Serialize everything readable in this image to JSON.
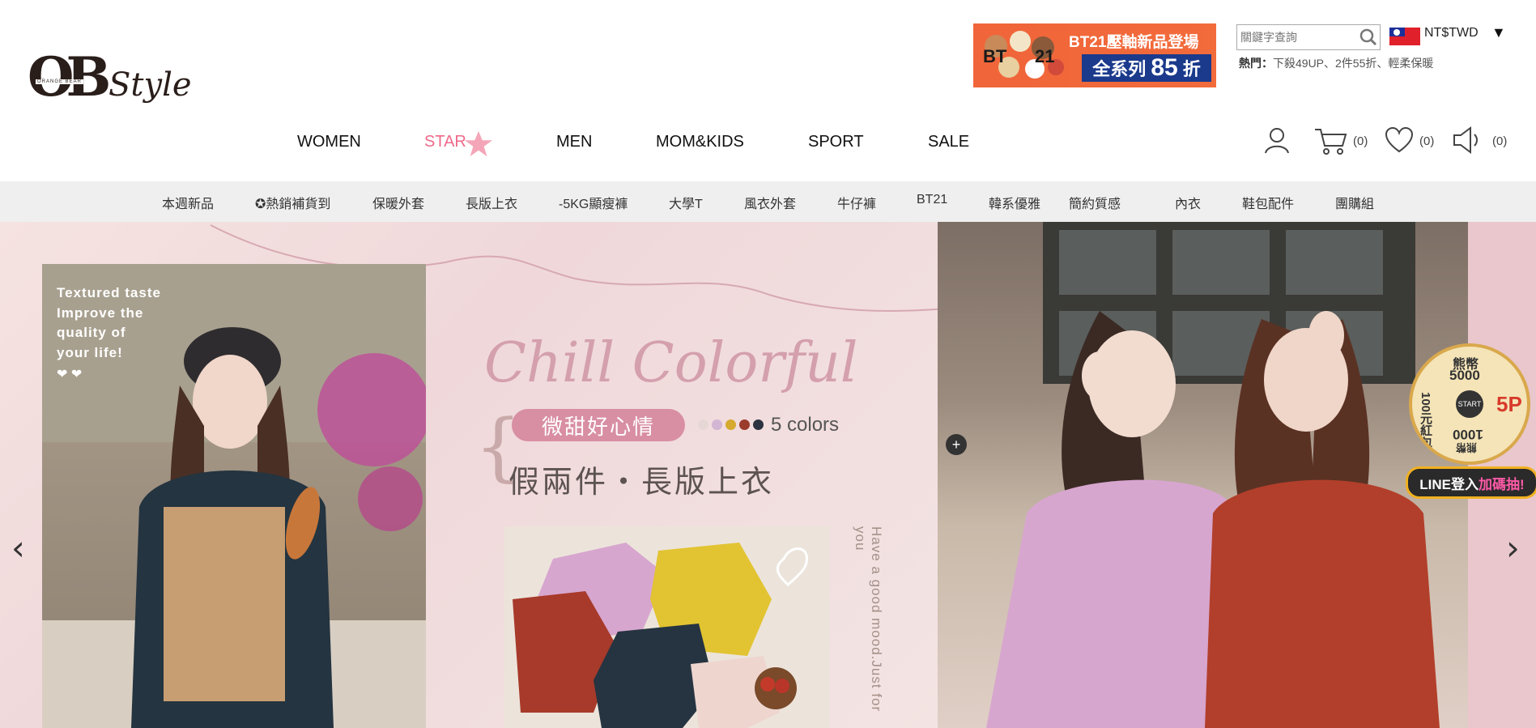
{
  "logo": {
    "main": "OB",
    "sub": "ORANGE BEAR",
    "style": "Style"
  },
  "banner": {
    "line1": "BT21壓軸新品登場",
    "line2_prefix": "全系列",
    "line2_num": "85",
    "line2_suffix": "折",
    "mark": "BT21"
  },
  "search": {
    "placeholder": "關鍵字查詢"
  },
  "hot": {
    "label": "熱門：",
    "text": "下殺49UP、2件55折、輕柔保暖"
  },
  "currency": {
    "label": "NT$TWD",
    "caret": "▼"
  },
  "main_nav": [
    "WOMEN",
    "STAR",
    "MEN",
    "MOM&KIDS",
    "SPORT",
    "SALE"
  ],
  "counts": {
    "cart": "(0)",
    "wishlist": "(0)",
    "notifications": "(0)"
  },
  "sub_nav": [
    "本週新品",
    "✪熱銷補貨到",
    "保暖外套",
    "長版上衣",
    "-5KG顯瘦褲",
    "大學T",
    "風衣外套",
    "牛仔褲",
    "BT21",
    "韓系優雅",
    "簡約質感",
    "內衣",
    "鞋包配件",
    "團購組"
  ],
  "hero": {
    "photo_text": [
      "Textured taste",
      "Improve the",
      "quality of",
      "your life!"
    ],
    "hearts": "❤ ❤",
    "script_title": "Chill Colorful",
    "pill": "微甜好心情",
    "colors_label": "5 colors",
    "subtitle": "假兩件・長版上衣",
    "vertical_text": "Have a good mood.Just for you",
    "plus": "+",
    "prev": "‹",
    "next": "›"
  },
  "promo": {
    "top": "熊幣",
    "top_num": "5000",
    "left": "100元紅包",
    "right": "5P",
    "bottom": "1000",
    "bottom_sub": "熊幣",
    "center": "START",
    "line_login": "LINE登入",
    "line_highlight": "加碼抽!"
  },
  "colors": {
    "dot1": "#e6d7d5",
    "dot2": "#d3b6d3",
    "dot3": "#d6a92f",
    "dot4": "#9b3b2b",
    "dot5": "#2b3340",
    "accent_pink": "#f06a8a"
  }
}
